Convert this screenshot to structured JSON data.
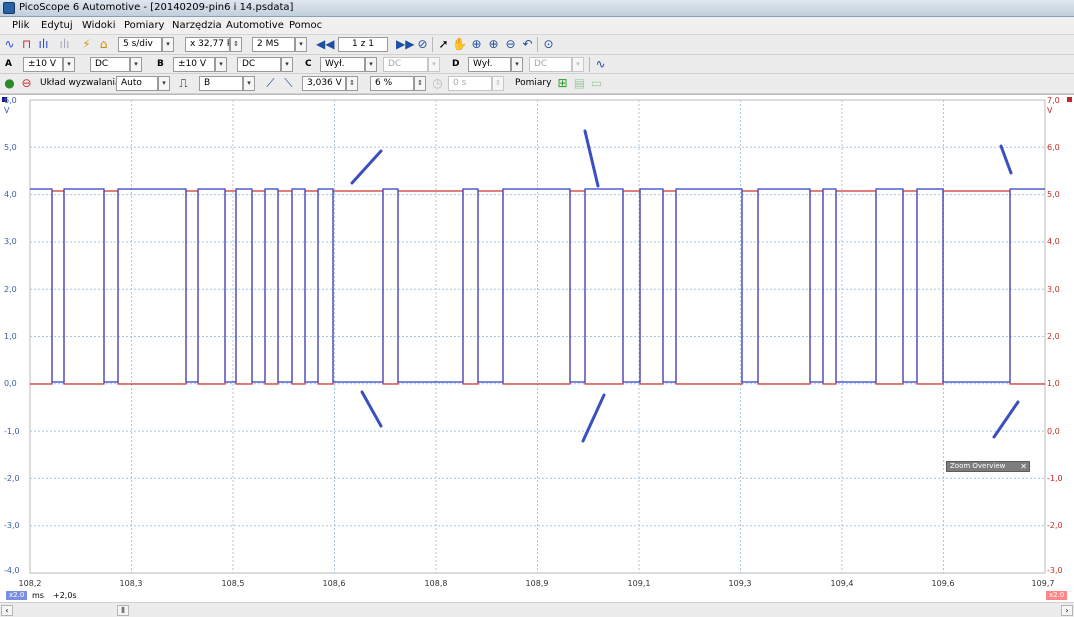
{
  "window": {
    "title": "PicoScope 6 Automotive - [20140209-pin6 i 14.psdata]"
  },
  "menu": [
    "Plik",
    "Edytuj",
    "Widoki",
    "Pomiary",
    "Narzędzia",
    "Automotive",
    "Pomoc"
  ],
  "toolbar1": {
    "timebase": "5 s/div",
    "zoom": "x 32,77 k",
    "samples": "2 MS",
    "buffer": "1 z 1"
  },
  "toolbar2": {
    "channels": [
      {
        "letter": "A",
        "range": "±10 V",
        "coupling": "DC",
        "color": "#2d4fbf"
      },
      {
        "letter": "B",
        "range": "±10 V",
        "coupling": "DC",
        "color": "#c0282c"
      },
      {
        "letter": "C",
        "range": "Wył.",
        "coupling": "DC",
        "color": "#2a8a2a"
      },
      {
        "letter": "D",
        "range": "Wył.",
        "coupling": "DC",
        "color": "#c8a000"
      }
    ]
  },
  "toolbar3": {
    "trigger_label": "Układ wyzwalania",
    "trigger_mode": "Auto",
    "trigger_source": "B",
    "threshold": "3,036 V",
    "pretrigger": "6 %",
    "delay": "0 s",
    "measurements_label": "Pomiary"
  },
  "plot": {
    "left_axis_labels": [
      "6,0",
      "5,0",
      "4,0",
      "3,0",
      "2,0",
      "1,0",
      "0,0",
      "-1,0",
      "-2,0",
      "-3,0",
      "-4,0"
    ],
    "left_unit": "V",
    "right_axis_labels": [
      "7,0",
      "6,0",
      "5,0",
      "4,0",
      "3,0",
      "2,0",
      "1,0",
      "0,0",
      "-1,0",
      "-2,0",
      "-3,0"
    ],
    "right_unit": "V",
    "x_axis_labels": [
      "108,2",
      "108,3",
      "108,5",
      "108,6",
      "108,8",
      "108,9",
      "109,1",
      "109,3",
      "109,4",
      "109,6",
      "109,7"
    ],
    "x_unit": "ms",
    "x_offset": "+2,0s",
    "zoom_badge_left": "x2.0",
    "zoom_badge_right": "x2.0",
    "series_colors": {
      "channel_a": "#2d3fc8",
      "channel_b": "#d0302f",
      "marker": "#3a4fc0"
    }
  },
  "zoom_overview": {
    "title": "Zoom Overview"
  }
}
